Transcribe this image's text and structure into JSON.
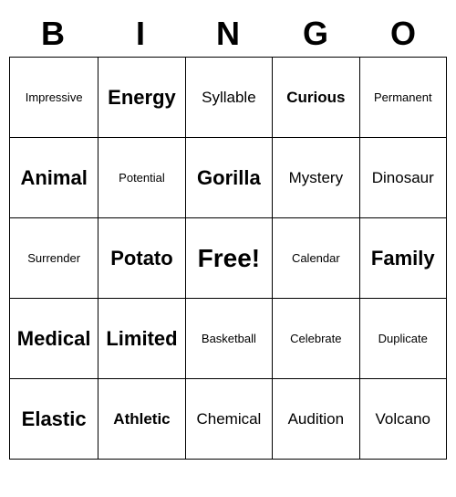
{
  "title": {
    "letters": [
      "B",
      "I",
      "N",
      "G",
      "O"
    ]
  },
  "grid": {
    "rows": [
      [
        {
          "text": "Impressive",
          "size": "small"
        },
        {
          "text": "Energy",
          "size": "large",
          "bold": true
        },
        {
          "text": "Syllable",
          "size": "medium"
        },
        {
          "text": "Curious",
          "size": "medium",
          "bold": true
        },
        {
          "text": "Permanent",
          "size": "small"
        }
      ],
      [
        {
          "text": "Animal",
          "size": "large",
          "bold": true
        },
        {
          "text": "Potential",
          "size": "small"
        },
        {
          "text": "Gorilla",
          "size": "large",
          "bold": true
        },
        {
          "text": "Mystery",
          "size": "medium"
        },
        {
          "text": "Dinosaur",
          "size": "medium"
        }
      ],
      [
        {
          "text": "Surrender",
          "size": "small"
        },
        {
          "text": "Potato",
          "size": "large",
          "bold": true
        },
        {
          "text": "Free!",
          "size": "free",
          "bold": true
        },
        {
          "text": "Calendar",
          "size": "small"
        },
        {
          "text": "Family",
          "size": "large",
          "bold": true
        }
      ],
      [
        {
          "text": "Medical",
          "size": "large",
          "bold": true
        },
        {
          "text": "Limited",
          "size": "large",
          "bold": true
        },
        {
          "text": "Basketball",
          "size": "small"
        },
        {
          "text": "Celebrate",
          "size": "small"
        },
        {
          "text": "Duplicate",
          "size": "small"
        }
      ],
      [
        {
          "text": "Elastic",
          "size": "large",
          "bold": true
        },
        {
          "text": "Athletic",
          "size": "medium",
          "bold": true
        },
        {
          "text": "Chemical",
          "size": "medium"
        },
        {
          "text": "Audition",
          "size": "medium"
        },
        {
          "text": "Volcano",
          "size": "medium"
        }
      ]
    ]
  }
}
